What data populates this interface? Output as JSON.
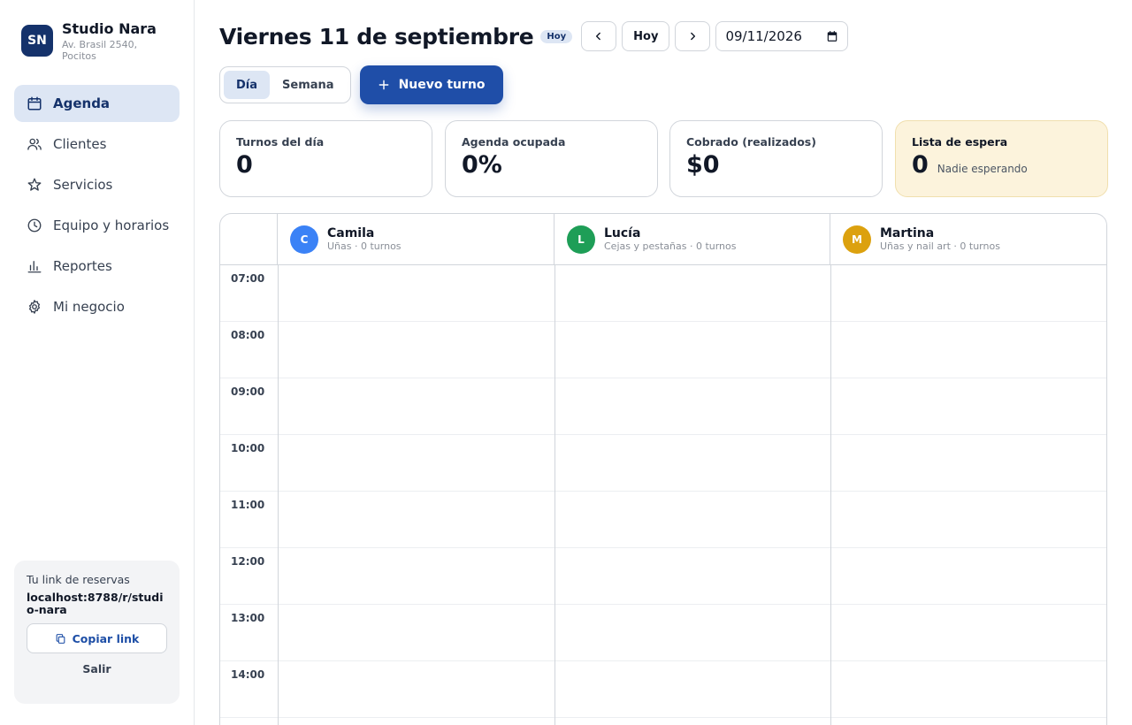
{
  "brand": {
    "initials": "SN",
    "name": "Studio Nara",
    "address": "Av. Brasil 2540, Pocitos",
    "logo_color": "#15326b"
  },
  "sidebar": {
    "items": [
      {
        "label": "Agenda",
        "icon": "calendar-icon",
        "active": true
      },
      {
        "label": "Clientes",
        "icon": "users-icon",
        "active": false
      },
      {
        "label": "Servicios",
        "icon": "star-icon",
        "active": false
      },
      {
        "label": "Equipo y horarios",
        "icon": "clock-icon",
        "active": false
      },
      {
        "label": "Reportes",
        "icon": "bar-chart-icon",
        "active": false
      },
      {
        "label": "Mi negocio",
        "icon": "gear-icon",
        "active": false
      }
    ],
    "booking": {
      "label": "Tu link de reservas",
      "url": "localhost:8788/r/studio-nara",
      "copy_label": "Copiar link",
      "logout_label": "Salir"
    }
  },
  "header": {
    "title": "Viernes 11 de septiembre",
    "today_badge": "Hoy",
    "today_button": "Hoy",
    "date_value": "09/11/2026"
  },
  "toolbar": {
    "view_day": "Día",
    "view_week": "Semana",
    "new_label": "Nuevo turno",
    "accent": "#1f4ea8"
  },
  "stats": [
    {
      "label": "Turnos del día",
      "value": "0"
    },
    {
      "label": "Agenda ocupada",
      "value": "0%"
    },
    {
      "label": "Cobrado (realizados)",
      "value": "$0"
    },
    {
      "label": "Lista de espera",
      "value": "0",
      "note": "Nadie esperando"
    }
  ],
  "staff": [
    {
      "initial": "C",
      "name": "Camila",
      "meta": "Uñas · 0 turnos",
      "color": "#3b82f6"
    },
    {
      "initial": "L",
      "name": "Lucía",
      "meta": "Cejas y pestañas · 0 turnos",
      "color": "#1e9e57"
    },
    {
      "initial": "M",
      "name": "Martina",
      "meta": "Uñas y nail art · 0 turnos",
      "color": "#dca10e"
    }
  ],
  "hours": [
    "07:00",
    "08:00",
    "09:00",
    "10:00",
    "11:00",
    "12:00",
    "13:00",
    "14:00"
  ]
}
